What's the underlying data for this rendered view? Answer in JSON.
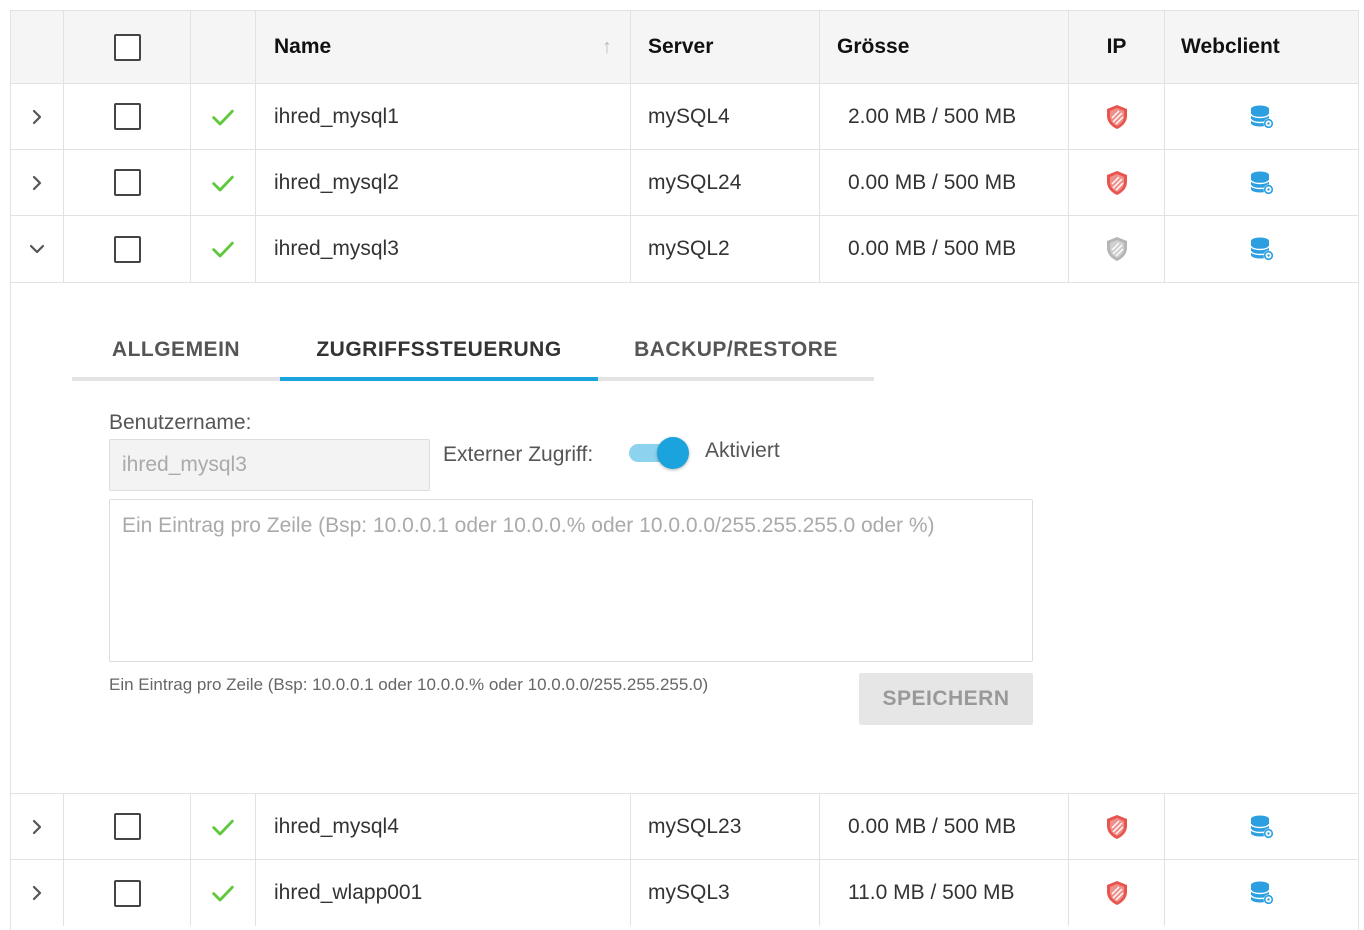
{
  "header": {
    "name": "Name",
    "server": "Server",
    "size": "Grösse",
    "ip": "IP",
    "webclient": "Webclient",
    "sort_icon": "↑"
  },
  "rows": [
    {
      "name": "ihred_mysql1",
      "server": "mySQL4",
      "size": "2.00 MB / 500 MB",
      "ip_status": "active",
      "expanded": false
    },
    {
      "name": "ihred_mysql2",
      "server": "mySQL24",
      "size": "0.00 MB / 500 MB",
      "ip_status": "active",
      "expanded": false
    },
    {
      "name": "ihred_mysql3",
      "server": "mySQL2",
      "size": "0.00 MB / 500 MB",
      "ip_status": "inactive",
      "expanded": true
    },
    {
      "name": "ihred_mysql4",
      "server": "mySQL23",
      "size": "0.00 MB / 500 MB",
      "ip_status": "active",
      "expanded": false
    },
    {
      "name": "ihred_wlapp001",
      "server": "mySQL3",
      "size": "11.0 MB / 500 MB",
      "ip_status": "active",
      "expanded": false
    }
  ],
  "detail": {
    "tabs": [
      {
        "label": "ALLGEMEIN",
        "active": false
      },
      {
        "label": "ZUGRIFFSSTEUERUNG",
        "active": true
      },
      {
        "label": "BACKUP/RESTORE",
        "active": false
      }
    ],
    "username_label": "Benutzername:",
    "username_value": "ihred_mysql3",
    "external_access_label": "Externer Zugriff:",
    "toggle_state_label": "Aktiviert",
    "toggle_on": true,
    "textarea_placeholder": "Ein Eintrag pro Zeile (Bsp: 10.0.0.1 oder 10.0.0.% oder 10.0.0.0/255.255.255.0 oder %)",
    "hint": "Ein Eintrag pro Zeile (Bsp: 10.0.0.1 oder 10.0.0.% oder 10.0.0.0/255.255.255.0)",
    "save_label": "SPEICHERN"
  },
  "colors": {
    "accent": "#1aa3dc",
    "check": "#5cc83a",
    "shield_active": "#e8554e",
    "shield_inactive": "#b5b5b5",
    "db_icon": "#2b9fe0"
  },
  "icons": {
    "expand": "chevron-right-icon",
    "collapse": "chevron-down-icon",
    "status": "check-icon",
    "ip": "shield-icon",
    "webclient": "database-icon"
  }
}
